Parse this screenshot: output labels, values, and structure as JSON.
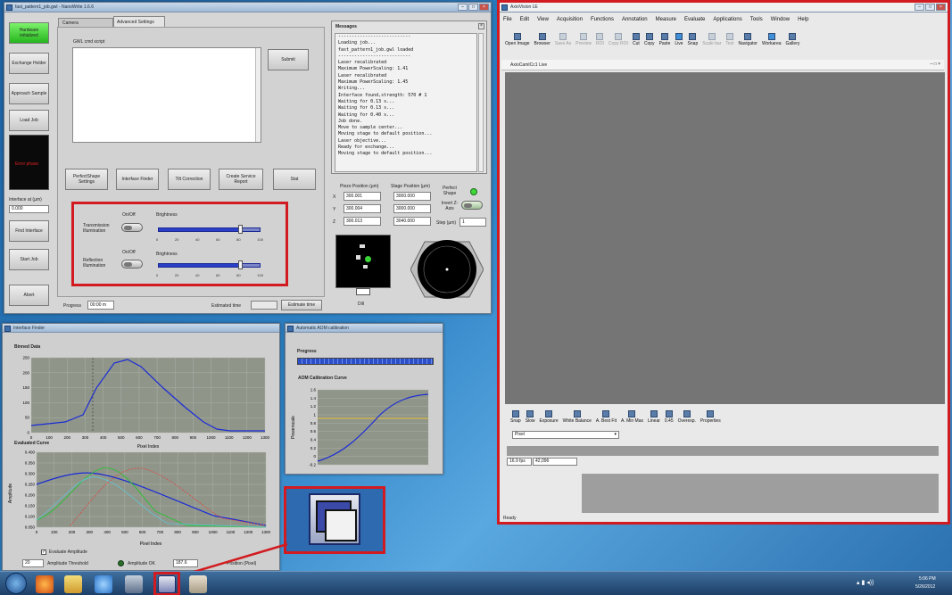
{
  "main_window": {
    "title": "fast_pattern1_job.gwl - NanoWrite 1.6.6",
    "left_buttons": [
      "Hardware initialized",
      "Exchange Holder",
      "Approach Sample",
      "Load Job",
      "Interface at (µm)",
      "Find Interface",
      "Start Job",
      "Abort"
    ],
    "error_label": "Error phase",
    "interface_value": "0.000",
    "tabs": [
      "Camera",
      "Advanced Settings"
    ],
    "gwl_label": "GWL cmd script",
    "submit_label": "Submit",
    "action_buttons": [
      "PerfectShape Settings",
      "Interface Finder",
      "Tilt Correction",
      "Create Service Report",
      "Stat"
    ],
    "transmission": {
      "onoff": "On/Off",
      "label": "Transmission Illumination",
      "brightness_label": "Brightness",
      "value": 0.8,
      "ticks": [
        "0",
        "20",
        "40",
        "60",
        "80",
        "100"
      ]
    },
    "reflection": {
      "onoff": "On/Off",
      "label": "Reflection Illumination",
      "brightness_label": "Brightness",
      "value": 0.8,
      "ticks": [
        "0",
        "20",
        "40",
        "60",
        "80",
        "100"
      ]
    },
    "progress_label": "Progress",
    "progress_value": "00:00 m",
    "estimated_label": "Estimated time",
    "estimate_button": "Estimate time",
    "messages_title": "Messages",
    "messages": [
      "---------------------------",
      "Loading job...",
      "fast_pattern1_job.gwl loaded",
      "---------------------------",
      "Laser recalibrated",
      "Maximum PowerScaling: 1.41",
      "Laser recalibrated",
      "Maximum PowerScaling: 1.45",
      "Writing...",
      "Interface found,strength: 570 # 1",
      "Waiting for 0.13 s...",
      "Waiting for 0.13 s...",
      "Waiting for 0.40 s...",
      "Job done.",
      "Move to sample center...",
      "Moving stage to default position...",
      "Laser objective...",
      "Ready for exchange...",
      "Moving stage to default position..."
    ],
    "piezo_label": "Piezo Position (µm)",
    "stage_label": "Stage Position (µm)",
    "axes": [
      "X",
      "Y",
      "Z"
    ],
    "piezo_values": [
      "300.001",
      "300.004",
      "300.013"
    ],
    "stage_values": [
      "3000.000",
      "3000.000",
      "3040.000"
    ],
    "perfect_shape_label": "Perfect Shape",
    "invert_label": "Invert Z-Axis",
    "step_label": "Step (µm)",
    "step_value": "1",
    "camera_caption": "Dill"
  },
  "interface_finder": {
    "title": "Interface Finder",
    "binned_title": "Binned Data",
    "binned_y_ticks": [
      "250",
      "200",
      "150",
      "100",
      "50",
      "0"
    ],
    "binned_x_ticks": [
      "0",
      "100",
      "200",
      "300",
      "400",
      "500",
      "600",
      "700",
      "800",
      "900",
      "1000",
      "1100",
      "1200",
      "1300"
    ],
    "x_label": "Pixel Index",
    "evaluated_title": "Evaluated Curve",
    "eval_y_ticks": [
      "0.400",
      "0.350",
      "0.300",
      "0.250",
      "0.200",
      "0.150",
      "0.100",
      "0.050"
    ],
    "eval_y_label": "Amplitude",
    "eval_x_ticks": [
      "0",
      "100",
      "200",
      "300",
      "400",
      "500",
      "600",
      "700",
      "800",
      "900",
      "1000",
      "1100",
      "1200",
      "1300"
    ],
    "eval_amp_label": "Evaluate Amplitude",
    "threshold_value": "20",
    "threshold_label": "Amplitude Threshold",
    "amp_ok_label": "Amplitude OK",
    "position_value": "187.6",
    "position_label": "Position (Pixel)"
  },
  "aom_window": {
    "title": "Automatic AOM calibration",
    "progress_label": "Progress",
    "curve_title": "AOM Calibration Curve",
    "y_label": "Powerscale",
    "y_ticks": [
      "1.6",
      "1.4",
      "1.2",
      "1",
      "0.8",
      "0.6",
      "0.4",
      "0.2",
      "0",
      "-0.2"
    ]
  },
  "axiovision": {
    "title": "AxioVision LE",
    "menu": [
      "File",
      "Edit",
      "View",
      "Acquisition",
      "Functions",
      "Annotation",
      "Measure",
      "Evaluate",
      "Applications",
      "Tools",
      "Window",
      "Help"
    ],
    "toolbar": [
      {
        "label": "Open Image",
        "dim": false,
        "sel": false
      },
      {
        "label": "Browser",
        "dim": false,
        "sel": false
      },
      {
        "label": "Save As",
        "dim": true,
        "sel": false
      },
      {
        "label": "Preview",
        "dim": true,
        "sel": false
      },
      {
        "label": "ROI",
        "dim": true,
        "sel": false
      },
      {
        "label": "Copy ROI",
        "dim": true,
        "sel": false
      },
      {
        "label": "Cut",
        "dim": false,
        "sel": false
      },
      {
        "label": "Copy",
        "dim": false,
        "sel": false
      },
      {
        "label": "Paste",
        "dim": false,
        "sel": false
      },
      {
        "label": "Live",
        "dim": false,
        "sel": true
      },
      {
        "label": "Snap",
        "dim": false,
        "sel": false
      },
      {
        "label": "Scale bar",
        "dim": true,
        "sel": false
      },
      {
        "label": "Text",
        "dim": true,
        "sel": false
      },
      {
        "label": "Navigator",
        "dim": false,
        "sel": false
      },
      {
        "label": "Workarea",
        "dim": false,
        "sel": true
      },
      {
        "label": "Gallery",
        "dim": false,
        "sel": false
      }
    ],
    "live_title": "AxioCamICc1 Live",
    "bottom_tools": [
      "Snap",
      "Slow",
      "Exposure",
      "White Balance",
      "A. Best Fit",
      "A. Min Max",
      "Linear",
      "0.45",
      "Overexp.",
      "Properties"
    ],
    "mode_select": "Pixel",
    "fps": "16.9 fps",
    "size": "42,096",
    "status": "Ready"
  },
  "taskbar": {
    "time": "5:06 PM",
    "date": "5/26/2012"
  }
}
